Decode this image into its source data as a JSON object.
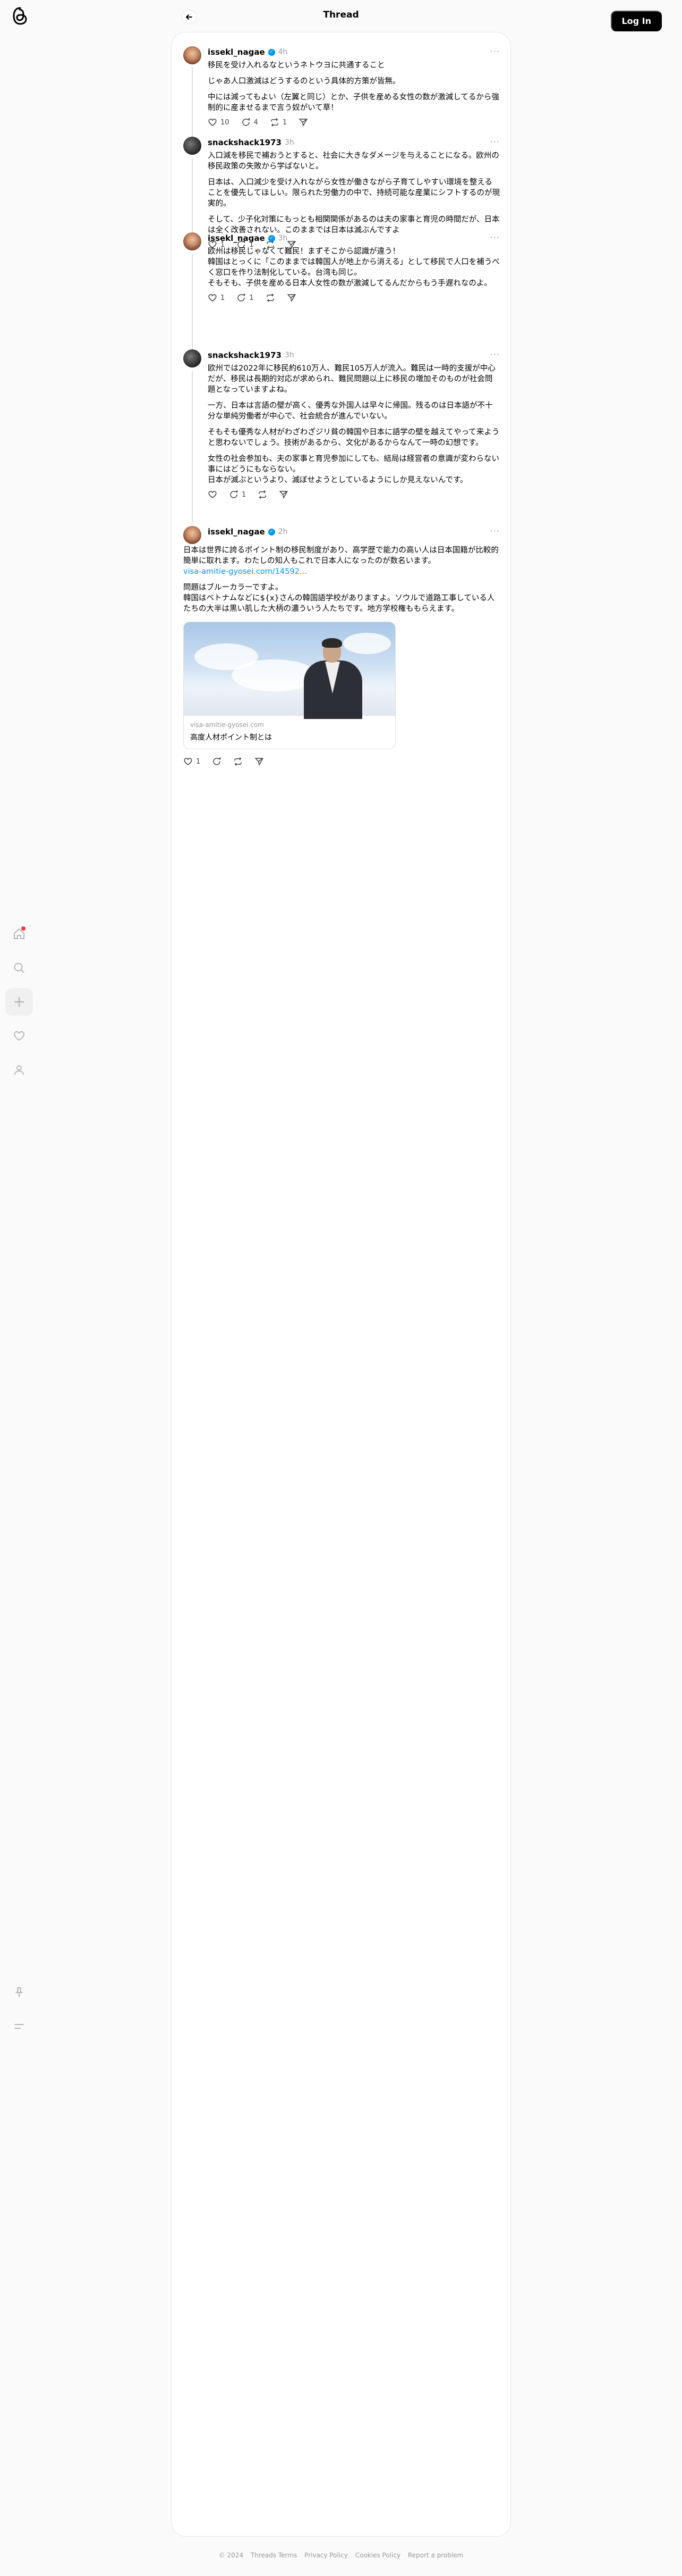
{
  "header": {
    "title": "Thread",
    "login_label": "Log In"
  },
  "posts": [
    {
      "user": "issekl_nagae",
      "verified": true,
      "time": "4h",
      "paragraphs": [
        "移民を受け入れるなというネトウヨに共通すること",
        "じゃあ人口激減はどうするのという具体的方策が皆無。",
        "中には減ってもよい（左翼と同じ）とか、子供を産める女性の数が激減してるから強制的に産ませるまで言う奴がいて草！"
      ],
      "likes": "10",
      "replies": "4",
      "reposts": "1"
    },
    {
      "user": "snackshack1973",
      "verified": false,
      "time": "3h",
      "paragraphs": [
        "入口減を移民で補おうとすると、社会に大きなダメージを与えることになる。欧州の移民政策の失敗から学ばないと。",
        "日本は、入口減少を受け入れながら女性が働きながら子育てしやすい環境を整えることを優先してほしい。限られた労働力の中で、持続可能な産業にシフトするのが現実的。",
        "そして、少子化対策にもっとも相関関係があるのは夫の家事と育児の時間だが、日本は全く改善されない。このままでは日本は滅ぶんですよ"
      ],
      "likes": "1",
      "replies": "1",
      "reposts": ""
    },
    {
      "user": "issekl_nagae",
      "verified": true,
      "time": "3h",
      "paragraphs": [
        "欧州は移民じゃなくて難民！まずそこから認識が違う！",
        "韓国はとっくに「このままでは韓国人が地上から消える」として移民で人口を補うべく窓口を作り法制化している。台湾も同じ。",
        "そもそも、子供を産める日本人女性の数が激減してるんだからもう手遅れなのよ。"
      ],
      "likes": "1",
      "replies": "1",
      "reposts": ""
    },
    {
      "user": "snackshack1973",
      "verified": false,
      "time": "3h",
      "paragraphs": [
        "欧州では2022年に移民約610万人、難民105万人が流入。難民は一時的支援が中心だが、移民は長期的対応が求められ、難民問題以上に移民の増加そのものが社会問題となっていますよね。",
        "一方、日本は言語の壁が高く、優秀な外国人は早々に帰国。残るのは日本語が不十分な単純労働者が中心で、社会統合が進んでいない。",
        "そもそも優秀な人材がわざわざジリ貧の韓国や日本に語学の壁を越えてやって来ようと思わないでしょう。技術があるから、文化があるからなんて一時の幻想です。",
        "女性の社会参加も、夫の家事と育児参加にしても、結局は経営者の意識が変わらない事にはどうにもならない。",
        "日本が滅ぶというより、滅ぼせようとしているようにしか見えないんです。"
      ],
      "likes": "",
      "replies": "1",
      "reposts": ""
    },
    {
      "user": "issekl_nagae",
      "verified": true,
      "time": "2h",
      "paragraphs": [
        "日本は世界に誇るポイント制の移民制度があり、高学歴で能力の高い人は日本国籍が比較的簡単に取れます。わたしの知人もこれで日本人になったのが数名います。",
        "問題はブルーカラーですよ。",
        "韓国はベトナムなどに${x}さんの韓国語学校がありますよ。ソウルで道路工事している人たちの大半は黒い肌した大柄の濃ういう人たちです。地方学校権ももらえます。"
      ],
      "link": "visa-amitie-gyosei.com/14592...",
      "card": {
        "domain": "visa-amitie-gyosei.com",
        "title": "高度人材ポイント制とは"
      },
      "likes": "1",
      "replies": "",
      "reposts": ""
    }
  ],
  "footer": {
    "items": [
      "© 2024",
      "Threads Terms",
      "Privacy Policy",
      "Cookies Policy",
      "Report a problem"
    ]
  }
}
